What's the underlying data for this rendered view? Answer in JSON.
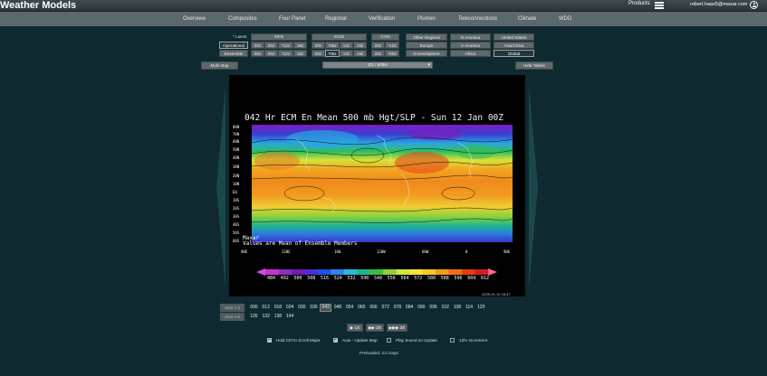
{
  "header": {
    "app_title": "Weather Models",
    "products_label": "Products",
    "user_email": "robert.haas5@maxar.com"
  },
  "nav": {
    "items": [
      "Overview",
      "Composites",
      "Four Panel",
      "Regional",
      "Verification",
      "Plumes",
      "Teleconnections",
      "Climate",
      "WDD"
    ]
  },
  "controls": {
    "latest_label": "* Latest",
    "operational": "Operational",
    "ensemble": "Ensemble",
    "gfs": {
      "label": "GFS",
      "row1": [
        "00z",
        "06z",
        "*12z",
        "18z"
      ],
      "row2": [
        "00z",
        "06z",
        "*12z",
        "18z"
      ]
    },
    "ecm": {
      "label": "ECM",
      "row1": [
        "00z",
        "*06z",
        "12z",
        "18z"
      ],
      "row2": [
        "00z",
        "*06z",
        "12z",
        "18z"
      ]
    },
    "can": {
      "label": "CAN",
      "row1": [
        "00z",
        "*12z"
      ],
      "row2": [
        "00z",
        "*00z"
      ]
    },
    "regions_col1": [
      "Other Regions",
      "Europe",
      "N Hemisphere"
    ],
    "regions_col2": [
      "N America",
      "S America",
      "Africa"
    ],
    "regions_col3": [
      "United States",
      "Asia/China",
      "Global"
    ],
    "multi_map": "Multi Map",
    "map_select": "Z/L / 500H",
    "hide_tables": "Hide Tables"
  },
  "map": {
    "title": "042 Hr ECM En Mean 500 mb Hgt/SLP - Sun 12 Jan 00Z",
    "footnote1": "Maxar",
    "footnote2": "Values are Mean of Ensemble Members",
    "lat_labels": [
      "80N",
      "70N",
      "60N",
      "50N",
      "40N",
      "30N",
      "20N",
      "10N",
      "EQ",
      "10S",
      "20S",
      "30S",
      "40S",
      "50S",
      "60S"
    ],
    "lon_labels": [
      "90E",
      "120E",
      "180",
      "120W",
      "60W",
      "0",
      "90E"
    ],
    "colorbar_labels": [
      "484",
      "492",
      "500",
      "508",
      "516",
      "524",
      "532",
      "540",
      "548",
      "556",
      "564",
      "572",
      "580",
      "588",
      "596",
      "604",
      "612"
    ],
    "colorbar_colors": [
      "#c832d2",
      "#9628c8",
      "#6e1eb4",
      "#4b2fd6",
      "#1e50e6",
      "#2f86e8",
      "#2bb7e0",
      "#1fb58c",
      "#3cbe3c",
      "#8cd23c",
      "#d2e63c",
      "#f5e632",
      "#f5c828",
      "#f59b1e",
      "#f06e14",
      "#e63c14",
      "#d21e1e"
    ],
    "timestamp": "2025-01-10 15:47"
  },
  "hours": {
    "start_labels": [
      "Start 1-3",
      "Start 4-6"
    ],
    "row1": [
      "006",
      "012",
      "018",
      "024",
      "030",
      "036",
      "042",
      "048",
      "054",
      "060",
      "066",
      "072",
      "078",
      "084",
      "090",
      "096",
      "102",
      "108",
      "114",
      "120"
    ],
    "row2": [
      "126",
      "132",
      "138",
      "144"
    ],
    "active": "042",
    "steps": [
      "▶ 1X",
      "▶▶ 2X",
      "▶▶▶ 3X"
    ]
  },
  "options": [
    {
      "label": "Hold Ctrl to Scroll Maps",
      "checked": true
    },
    {
      "label": "Auto - Update Map",
      "checked": true
    },
    {
      "label": "Play Sound on Update",
      "checked": false
    },
    {
      "label": "12hr Increment",
      "checked": false
    }
  ],
  "preloaded": "Preloaded: 23 maps"
}
